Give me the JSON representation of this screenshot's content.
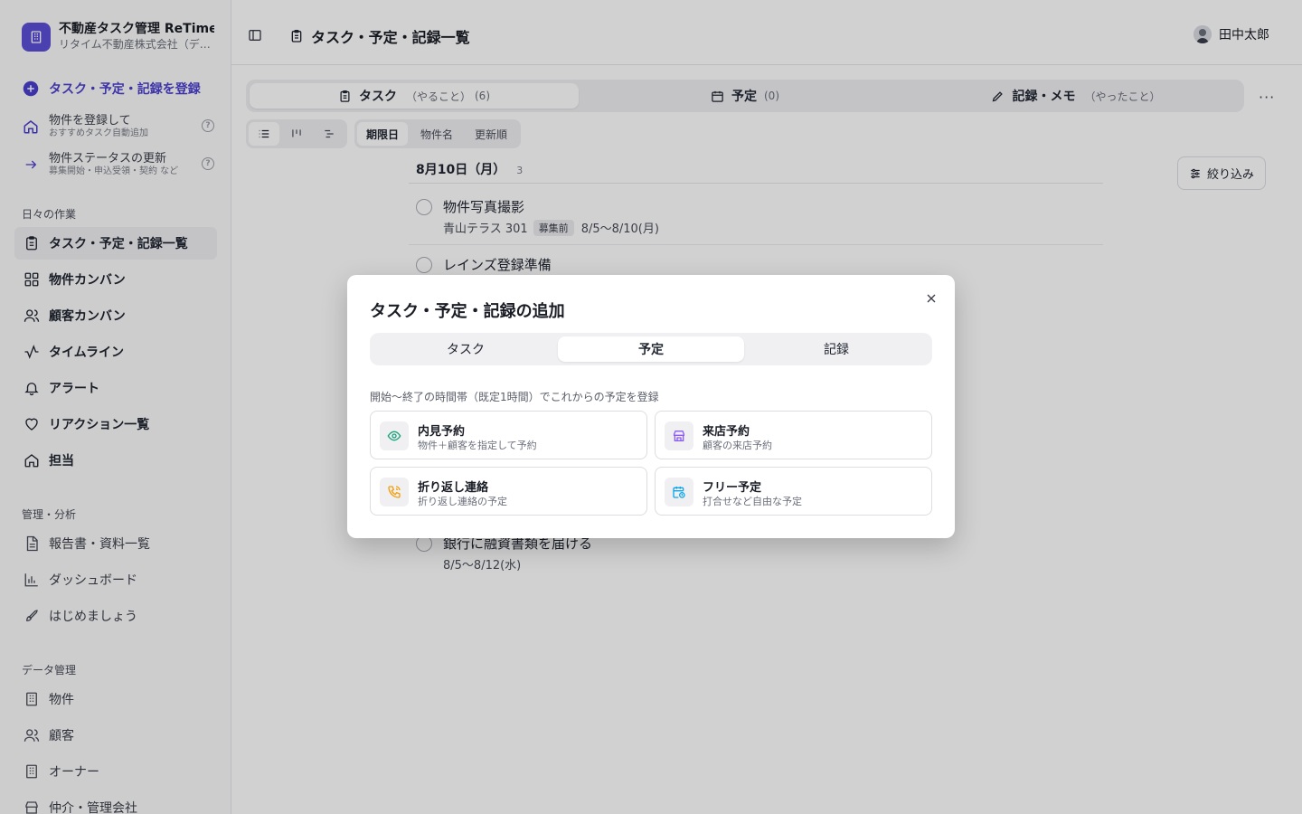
{
  "brand": {
    "title": "不動産タスク管理 ReTime",
    "subtitle": "リタイム不動産株式会社（デモ）"
  },
  "sidebar": {
    "primary_action": "タスク・予定・記録を登録",
    "register_property": {
      "title": "物件を登録して",
      "sub": "おすすめタスク自動追加"
    },
    "update_status": {
      "title": "物件ステータスの更新",
      "sub": "募集開始・申込受領・契約 など"
    },
    "help_glyph": "?",
    "sections": {
      "daily": "日々の作業",
      "management": "管理・分析",
      "data": "データ管理"
    },
    "daily_items": [
      {
        "label": "タスク・予定・記録一覧",
        "icon": "clipboard-icon"
      },
      {
        "label": "物件カンバン",
        "icon": "grid-icon"
      },
      {
        "label": "顧客カンバン",
        "icon": "users-icon"
      },
      {
        "label": "タイムライン",
        "icon": "activity-icon"
      },
      {
        "label": "アラート",
        "icon": "bell-icon"
      },
      {
        "label": "リアクション一覧",
        "icon": "heart-icon"
      },
      {
        "label": "担当",
        "icon": "home-icon"
      }
    ],
    "management_items": [
      {
        "label": "報告書・資料一覧",
        "icon": "file-icon"
      },
      {
        "label": "ダッシュボード",
        "icon": "bar-chart-icon"
      },
      {
        "label": "はじめましょう",
        "icon": "rocket-icon"
      }
    ],
    "data_items": [
      {
        "label": "物件",
        "icon": "building-icon"
      },
      {
        "label": "顧客",
        "icon": "users-icon"
      },
      {
        "label": "オーナー",
        "icon": "building-icon"
      },
      {
        "label": "仲介・管理会社",
        "icon": "store-icon"
      }
    ]
  },
  "topbar": {
    "title": "タスク・予定・記録一覧",
    "user": "田中太郎"
  },
  "tabs": [
    {
      "label": "タスク",
      "sub": "（やること）",
      "count": "(6)"
    },
    {
      "label": "予定",
      "sub": "",
      "count": "(0)"
    },
    {
      "label": "記録・メモ",
      "sub": "（やったこと）",
      "count": ""
    }
  ],
  "more_glyph": "···",
  "sort": [
    "期限日",
    "物件名",
    "更新順"
  ],
  "filter_label": "絞り込み",
  "date_group": {
    "date": "8月10日（月）",
    "count": "3"
  },
  "tasks": [
    {
      "title": "物件写真撮影",
      "property": "青山テラス 301",
      "badge": "募集前",
      "range": "8/5〜8/10(月)"
    },
    {
      "title": "レインズ登録準備",
      "property": "",
      "badge": "",
      "range": ""
    },
    {
      "title": "銀行に融資書類を届ける",
      "property": "",
      "badge": "",
      "range": "8/5〜8/12(水)"
    }
  ],
  "modal": {
    "title": "タスク・予定・記録の追加",
    "tabs": [
      "タスク",
      "予定",
      "記録"
    ],
    "active_tab": "予定",
    "hint": "開始〜終了の時間帯（既定1時間）でこれからの予定を登録",
    "cards": [
      {
        "title": "内見予約",
        "sub": "物件＋顧客を指定して予約",
        "icon": "eye-icon",
        "color": "#16a37a"
      },
      {
        "title": "来店予約",
        "sub": "顧客の来店予約",
        "icon": "store-icon",
        "color": "#8b5cf6"
      },
      {
        "title": "折り返し連絡",
        "sub": "折り返し連絡の予定",
        "icon": "phone-icon",
        "color": "#f59e0b"
      },
      {
        "title": "フリー予定",
        "sub": "打合せなど自由な予定",
        "icon": "calendar-clock-icon",
        "color": "#0ea5e9"
      }
    ]
  },
  "colors": {
    "accent": "#4b3fcf",
    "brand_logo": "#5b4fd6"
  }
}
